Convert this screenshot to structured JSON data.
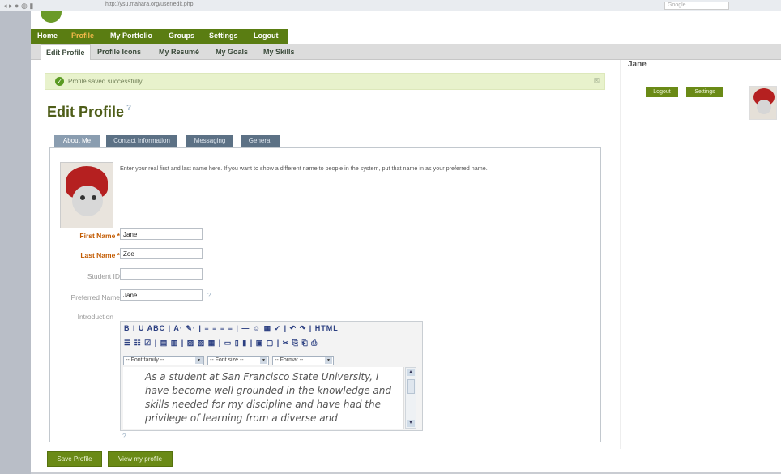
{
  "browser": {
    "nav_glyphs": "◂ ▸ ● ◍ ▮",
    "url": "http://ysu.mahara.org/user/edit.php",
    "search_placeholder": "Google"
  },
  "main_nav": [
    "Home",
    "Profile",
    "My Portfolio",
    "Groups",
    "Settings",
    "Logout"
  ],
  "sub_nav": [
    "Edit Profile",
    "Profile Icons",
    "My Resumé",
    "My Goals",
    "My Skills"
  ],
  "message": {
    "text": "Profile saved successfully",
    "close": "☒",
    "check": "✓"
  },
  "page_title": "Edit Profile",
  "help_glyph": "?",
  "tabs": [
    "About Me",
    "Contact Information",
    "Messaging",
    "General"
  ],
  "intro_text": "Enter your real first and last name here. If you want to show a different name to people in the system, put that name in as your preferred name.",
  "fields": {
    "first_name": {
      "label": "First Name *",
      "value": "Jane"
    },
    "last_name": {
      "label": "Last Name *",
      "value": "Zoe"
    },
    "student_id": {
      "label": "Student ID",
      "value": ""
    },
    "preferred_name": {
      "label": "Preferred Name",
      "value": "Jane"
    },
    "introduction": {
      "label": "Introduction"
    }
  },
  "editor": {
    "toolbar_row1": "B I U ABC | A· ✎· | ≡ ≡ ≡ ≡ | — ☺ ▦ ✓ | ↶ ↷ | HTML",
    "toolbar_row2": "☰ ☷ ☑ | ▤ ▥ | ▨ ▧ ▦ | ▭ ▯ ▮ | ▣ ▢ | ✂ ⎘ ⎗ ⎙",
    "font_family": "-- Font family --",
    "font_size": "-- Font size --",
    "format": "-- Format --",
    "dropdown_arrow": "▾",
    "content": "As a student at San Francisco State University, I have become well grounded in the knowledge and skills needed for my discipline and have had the privilege of learning from a diverse and",
    "scroll_up": "▴",
    "scroll_down": "▾"
  },
  "buttons": {
    "save": "Save Profile",
    "view": "View my profile"
  },
  "sidebar": {
    "name": "Jane",
    "logout": "Logout",
    "settings": "Settings"
  }
}
